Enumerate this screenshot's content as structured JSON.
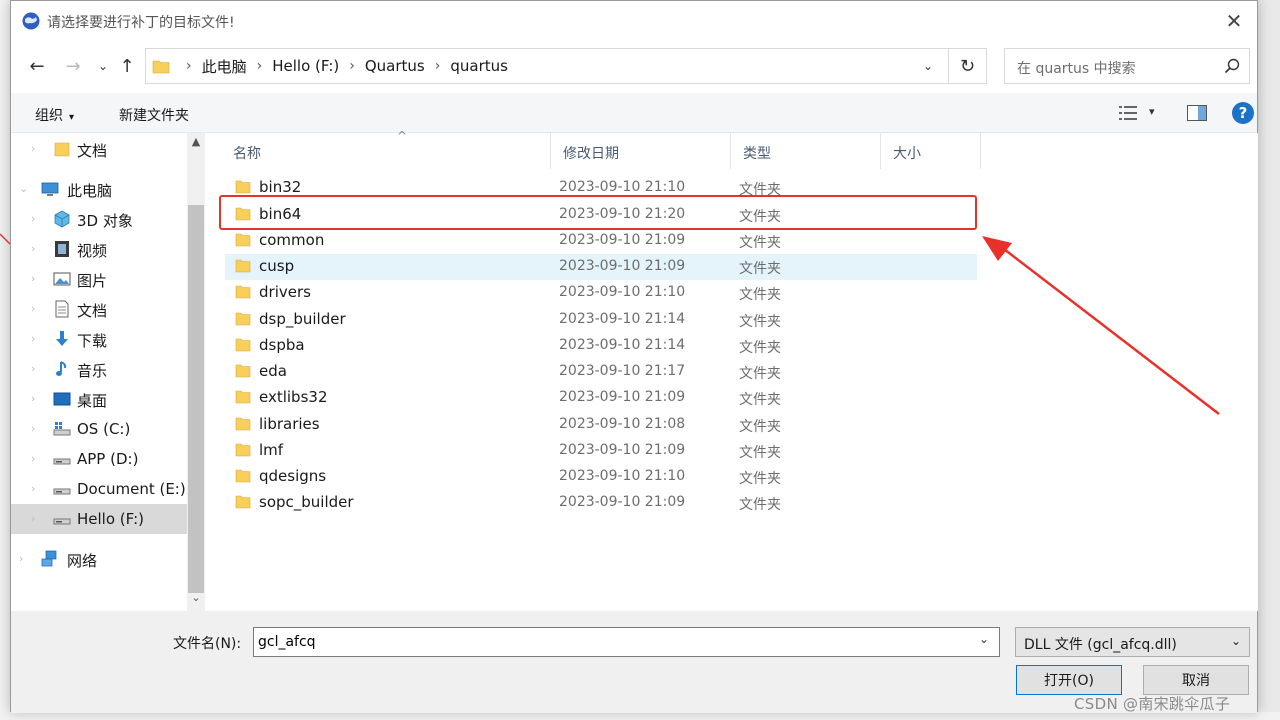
{
  "window": {
    "title": "请选择要进行补丁的目标文件!",
    "close_symbol": "✕"
  },
  "nav": {
    "back": "←",
    "forward": "→",
    "recent": "⌄",
    "up": "↑",
    "breadcrumbs": [
      "此电脑",
      "Hello (F:)",
      "Quartus",
      "quartus"
    ],
    "dropdown": "⌄",
    "refresh": "↻",
    "search_placeholder": "在 quartus 中搜索"
  },
  "toolbar": {
    "organize": "组织",
    "organize_caret": "▾",
    "new_folder": "新建文件夹",
    "view_caret": "▾",
    "help": "?"
  },
  "sidebar": {
    "items": [
      {
        "label": "文档",
        "icon": "folder-icon"
      },
      {
        "label": "此电脑",
        "icon": "computer-icon"
      },
      {
        "label": "3D 对象",
        "icon": "cube-icon"
      },
      {
        "label": "视频",
        "icon": "video-icon"
      },
      {
        "label": "图片",
        "icon": "picture-icon"
      },
      {
        "label": "文档",
        "icon": "document-icon"
      },
      {
        "label": "下载",
        "icon": "download-icon"
      },
      {
        "label": "音乐",
        "icon": "music-icon"
      },
      {
        "label": "桌面",
        "icon": "desktop-icon"
      },
      {
        "label": "OS (C:)",
        "icon": "system-drive-icon"
      },
      {
        "label": "APP (D:)",
        "icon": "drive-icon"
      },
      {
        "label": "Document (E:)",
        "icon": "drive-icon"
      },
      {
        "label": "Hello (F:)",
        "icon": "drive-icon"
      },
      {
        "label": "网络",
        "icon": "network-icon"
      }
    ],
    "chevron": "›",
    "chevron_open": "⌄",
    "scroll_up": "▲",
    "scroll_down": "⌄"
  },
  "columns": {
    "name": "名称",
    "modified": "修改日期",
    "type": "类型",
    "size": "大小",
    "sort_caret": "^"
  },
  "files": [
    {
      "name": "bin32",
      "date": "2023-09-10 21:10",
      "type": "文件夹"
    },
    {
      "name": "bin64",
      "date": "2023-09-10 21:20",
      "type": "文件夹"
    },
    {
      "name": "common",
      "date": "2023-09-10 21:09",
      "type": "文件夹"
    },
    {
      "name": "cusp",
      "date": "2023-09-10 21:09",
      "type": "文件夹"
    },
    {
      "name": "drivers",
      "date": "2023-09-10 21:10",
      "type": "文件夹"
    },
    {
      "name": "dsp_builder",
      "date": "2023-09-10 21:14",
      "type": "文件夹"
    },
    {
      "name": "dspba",
      "date": "2023-09-10 21:14",
      "type": "文件夹"
    },
    {
      "name": "eda",
      "date": "2023-09-10 21:17",
      "type": "文件夹"
    },
    {
      "name": "extlibs32",
      "date": "2023-09-10 21:09",
      "type": "文件夹"
    },
    {
      "name": "libraries",
      "date": "2023-09-10 21:08",
      "type": "文件夹"
    },
    {
      "name": "lmf",
      "date": "2023-09-10 21:09",
      "type": "文件夹"
    },
    {
      "name": "qdesigns",
      "date": "2023-09-10 21:10",
      "type": "文件夹"
    },
    {
      "name": "sopc_builder",
      "date": "2023-09-10 21:09",
      "type": "文件夹"
    }
  ],
  "bottom": {
    "filename_label": "文件名(N):",
    "filename_value": "gcl_afcq",
    "filename_drop": "⌄",
    "filetype": "DLL 文件 (gcl_afcq.dll)",
    "filetype_caret": "⌄",
    "open_button": "打开(O)",
    "cancel_button": "取消"
  },
  "watermark": "CSDN @南宋跳伞瓜子",
  "colors": {
    "annotation_red": "#e8312a",
    "folder_yellow": "#f8cf5a",
    "hover_blue": "#e5f3fb",
    "accent_blue": "#1a73c8"
  }
}
